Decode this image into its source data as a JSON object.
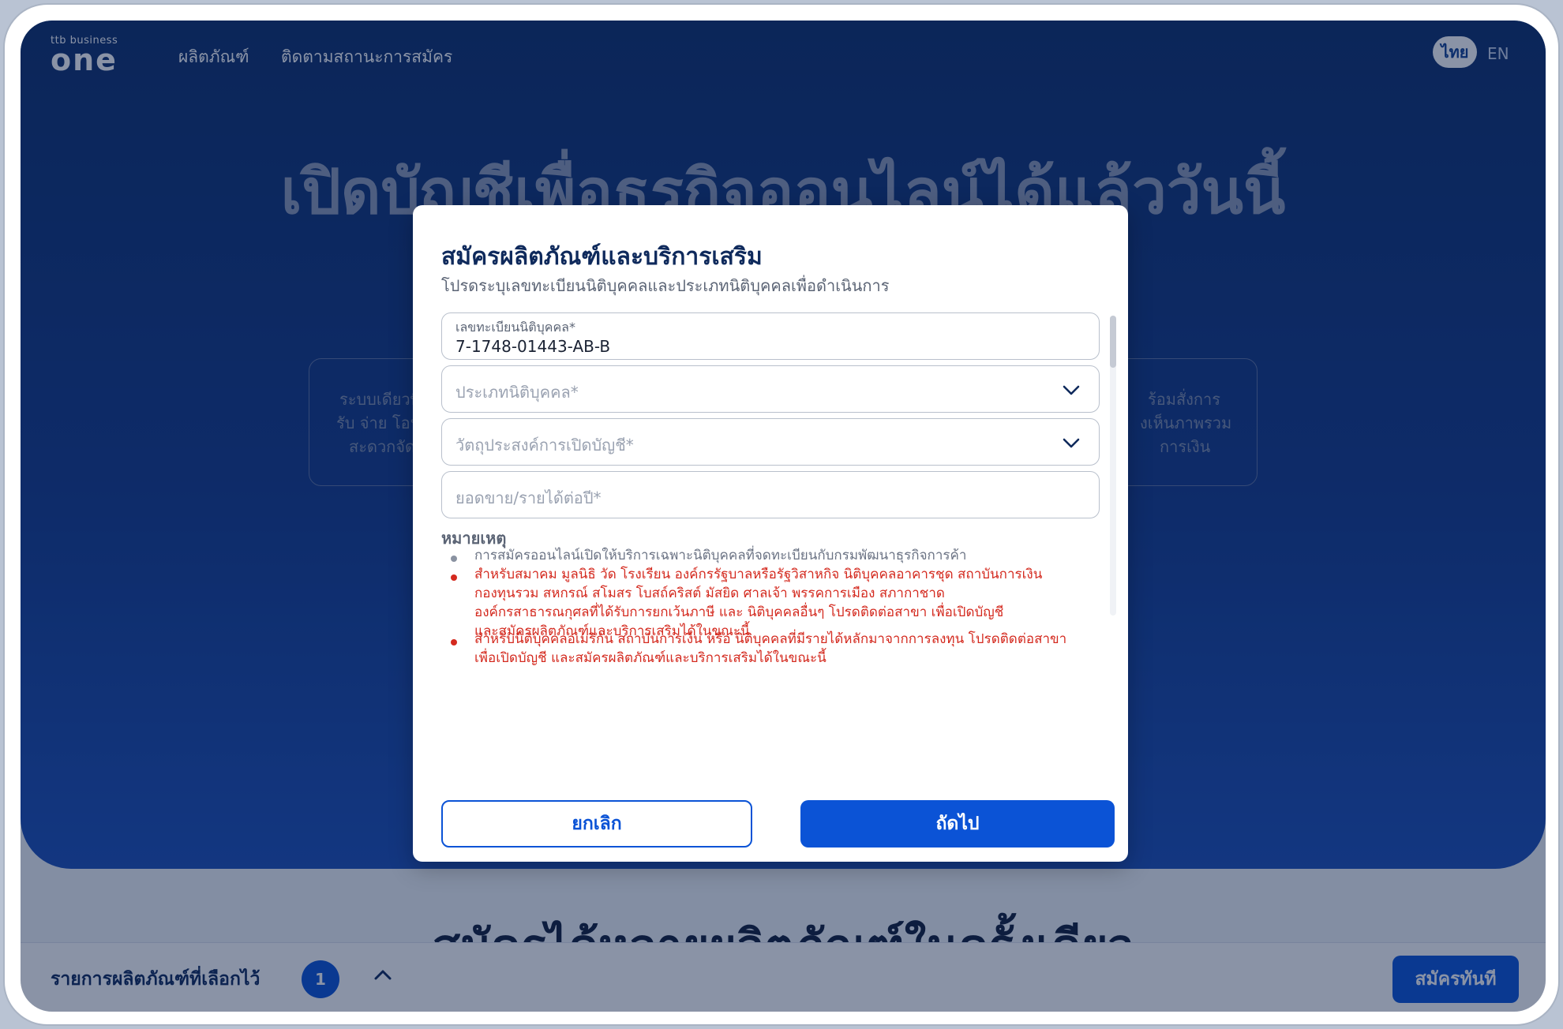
{
  "header": {
    "logo_small": "ttb business",
    "logo_big": "one",
    "nav": [
      "ผลิตภัณฑ์",
      "ติดตามสถานะการสมัคร"
    ],
    "lang_th": "ไทย",
    "lang_en": "EN"
  },
  "hero": {
    "headline": "เปิดบัญชีเพื่อธุรกิจออนไลน์ได้แล้ววันนี้",
    "feature_left": [
      "ระบบเดียวที่",
      "รับ จ่าย โอนเ",
      "สะดวกจัดก"
    ],
    "feature_right": [
      "ร้อมสั่งการ",
      "งเห็นภาพรวม",
      "การเงิน"
    ]
  },
  "lower": {
    "title": "สมัครได้หลายผลิตภัณฑ์ในครั้งเดียว"
  },
  "bottom_bar": {
    "label": "รายการผลิตภัณฑ์ที่เลือกไว้",
    "count": "1",
    "apply": "สมัครทันที"
  },
  "modal": {
    "title": "สมัครผลิตภัณฑ์และบริการเสริม",
    "subtitle": "โปรดระบุเลขทะเบียนนิติบุคคลและประเภทนิติบุคคลเพื่อดำเนินการ",
    "reg_label": "เลขทะเบียนนิติบุคคล*",
    "reg_value": "7-1748-01443-AB-B",
    "type_placeholder": "ประเภทนิติบุคคล*",
    "purpose_placeholder": "วัตถุประสงค์การเปิดบัญชี*",
    "revenue_placeholder": "ยอดขาย/รายได้ต่อปี*",
    "note_heading": "หมายเหตุ",
    "note1": "การสมัครออนไลน์เปิดให้บริการเฉพาะนิติบุคคลที่จดทะเบียนกับกรมพัฒนาธุรกิจการค้า",
    "note2": [
      "สำหรับสมาคม มูลนิธิ วัด โรงเรียน องค์กรรัฐบาลหรือรัฐวิสาหกิจ นิติบุคคลอาคารชุด สถาบันการเงิน",
      "กองทุนรวม สหกรณ์ สโมสร โบสถ์คริสต์ มัสยิด ศาลเจ้า พรรคการเมือง สภากาชาด",
      "องค์กรสาธารณกุศลที่ได้รับการยกเว้นภาษี และ นิติบุคคลอื่นๆ โปรดติดต่อสาขา เพื่อเปิดบัญชี",
      "และสมัครผลิตภัณฑ์และบริการเสริมได้ในขณะนี้"
    ],
    "note3": [
      "สำหรับนิติบุคคลอเมริกัน สถาบันการเงิน หรือ นิติบุคคลที่มีรายได้หลักมาจากการลงทุน โปรดติดต่อสาขา",
      "เพื่อเปิดบัญชี และสมัครผลิตภัณฑ์และบริการเสริมได้ในขณะนี้"
    ],
    "cancel": "ยกเลิก",
    "next": "ถัดไป"
  },
  "colors": {
    "primary": "#0b53d6",
    "navy": "#0f2a5c",
    "warning": "#d42a1f"
  }
}
